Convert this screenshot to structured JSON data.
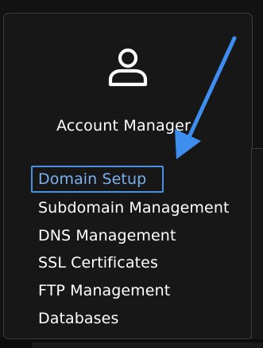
{
  "account": {
    "title": "Account Manager",
    "icon": "user-icon"
  },
  "menu": {
    "items": [
      {
        "label": "Domain Setup",
        "active": true
      },
      {
        "label": "Subdomain Management",
        "active": false
      },
      {
        "label": "DNS Management",
        "active": false
      },
      {
        "label": "SSL Certificates",
        "active": false
      },
      {
        "label": "FTP Management",
        "active": false
      },
      {
        "label": "Databases",
        "active": false
      }
    ]
  },
  "colors": {
    "background": "#121212",
    "panel": "#171717",
    "text": "#ffffff",
    "active_text": "#7ab0f0",
    "highlight": "#4a8fe0",
    "arrow": "#3e8ef0"
  }
}
